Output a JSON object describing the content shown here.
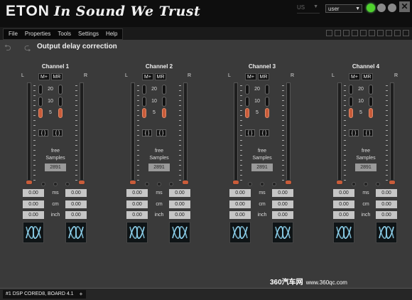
{
  "header": {
    "brand": "ETON",
    "slogan": "In Sound We Trust",
    "lang": "US",
    "user": "user",
    "close": "✕"
  },
  "menu": [
    "File",
    "Properties",
    "Tools",
    "Settings",
    "Help"
  ],
  "page_title": "Output delay correction",
  "labels": {
    "left": "L",
    "right": "R",
    "m_plus": "M+",
    "m_r": "MR",
    "n20": "20",
    "n10": "10",
    "n5": "5",
    "bracket": "{ }",
    "free": "free",
    "samples": "Samples",
    "ms": "ms",
    "cm": "cm",
    "inch": "inch"
  },
  "channels": [
    {
      "title": "Channel 1",
      "samples": "2891",
      "ms_l": "0.00",
      "ms_r": "0.00",
      "cm_l": "0.00",
      "cm_r": "0.00",
      "inch_l": "0.00",
      "inch_r": "0.00"
    },
    {
      "title": "Channel 2",
      "samples": "2891",
      "ms_l": "0.00",
      "ms_r": "0.00",
      "cm_l": "0.00",
      "cm_r": "0.00",
      "inch_l": "0.00",
      "inch_r": "0.00"
    },
    {
      "title": "Channel 3",
      "samples": "2891",
      "ms_l": "0.00",
      "ms_r": "0.00",
      "cm_l": "0.00",
      "cm_r": "0.00",
      "inch_l": "0.00",
      "inch_r": "0.00"
    },
    {
      "title": "Channel 4",
      "samples": "2891",
      "ms_l": "0.00",
      "ms_r": "0.00",
      "cm_l": "0.00",
      "cm_r": "0.00",
      "inch_l": "0.00",
      "inch_r": "0.00"
    }
  ],
  "footer": {
    "tab": "#1 DSP CORED8, BOARD 4.1",
    "add": "+"
  },
  "watermark": {
    "main": "360汽车网",
    "url": "www.360qc.com"
  },
  "colors": {
    "accent": "#c95c3a",
    "status_green": "#4fd22c"
  }
}
